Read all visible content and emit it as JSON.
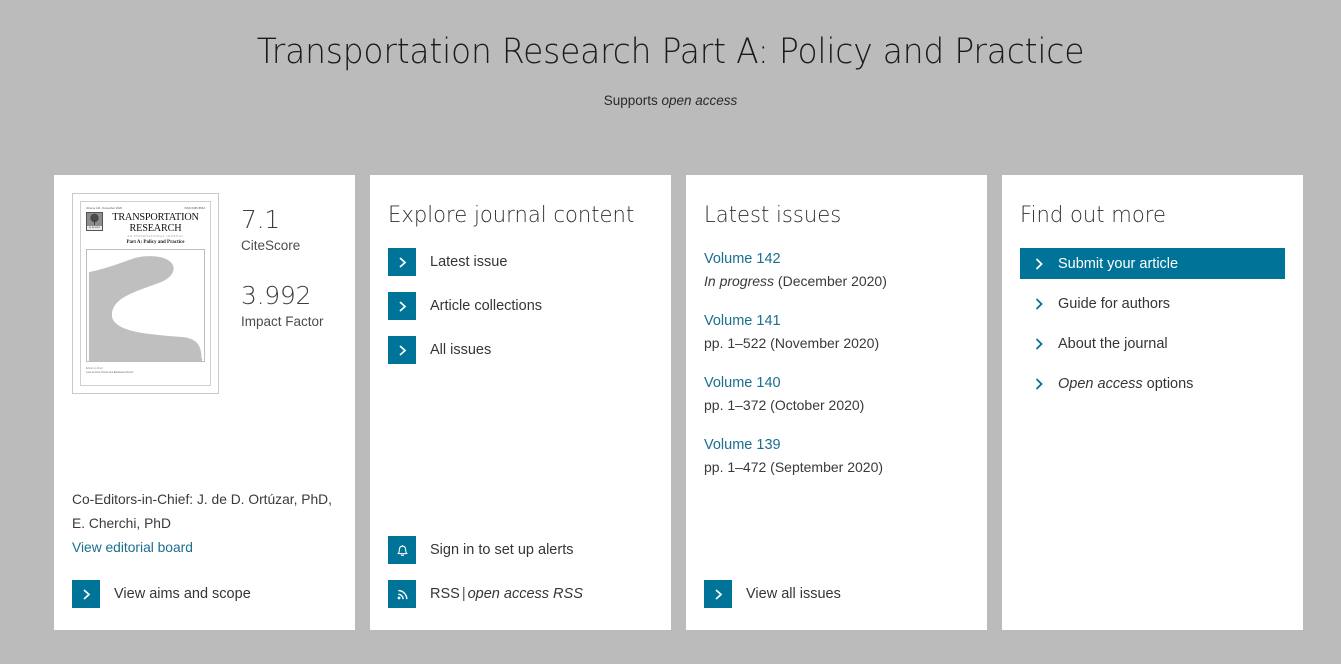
{
  "header": {
    "title": "Transportation Research Part A: Policy and Practice",
    "supports_prefix": "Supports ",
    "supports_oa": "open access"
  },
  "journal_card": {
    "cover": {
      "top_left": "Volume 141, November 2020",
      "top_right": "ISSN 0965-8564",
      "publisher": "ELSEVIER",
      "title_line1": "TRANSPORTATION",
      "title_line2": "RESEARCH",
      "intl_line": "AN INTERNATIONAL JOURNAL",
      "part_line": "Part A: Policy and Practice",
      "footer_line1": "Editors-in-Chief",
      "footer_line2": "Juan de Dios Ortúzar and Elisabetta Cherchi"
    },
    "metrics": [
      {
        "value": "7.1",
        "label": "CiteScore"
      },
      {
        "value": "3.992",
        "label": "Impact Factor"
      }
    ],
    "editors_line1": "Co-Editors-in-Chief: J. de D. Ortúzar, PhD,",
    "editors_line2": "E. Cherchi, PhD",
    "editorial_board_link": "View editorial board",
    "aims_and_scope": "View aims and scope"
  },
  "explore_card": {
    "heading": "Explore journal content",
    "links": [
      {
        "label": "Latest issue",
        "icon": "chevron-right-icon"
      },
      {
        "label": "Article collections",
        "icon": "chevron-right-icon"
      },
      {
        "label": "All issues",
        "icon": "chevron-right-icon"
      }
    ],
    "alerts": {
      "label": "Sign in to set up alerts",
      "icon": "bell-icon"
    },
    "rss": {
      "label_plain": "RSS",
      "separator": "|",
      "label_oa": "open access RSS",
      "icon": "rss-icon"
    }
  },
  "issues_card": {
    "heading": "Latest issues",
    "issues": [
      {
        "volume": "Volume 142",
        "status": "In progress",
        "meta": " (December 2020)",
        "status_italic": true
      },
      {
        "volume": "Volume 141",
        "status": "pp. 1–522",
        "meta": " (November 2020)",
        "status_italic": false
      },
      {
        "volume": "Volume 140",
        "status": "pp. 1–372",
        "meta": " (October 2020)",
        "status_italic": false
      },
      {
        "volume": "Volume 139",
        "status": "pp. 1–472",
        "meta": " (September 2020)",
        "status_italic": false
      }
    ],
    "view_all": "View all issues"
  },
  "find_out_more_card": {
    "heading": "Find out more",
    "items": [
      {
        "label": "Submit your article",
        "primary": true
      },
      {
        "label": "Guide for authors",
        "primary": false
      },
      {
        "label": "About the journal",
        "primary": false
      },
      {
        "label_italic": "Open access",
        "label_rest": " options",
        "primary": false
      }
    ]
  },
  "colors": {
    "accent_teal": "#007398",
    "link_teal": "#1a6f8e",
    "page_bg": "#bbbbbb",
    "card_bg": "#ffffff",
    "text_dark": "#353535"
  }
}
